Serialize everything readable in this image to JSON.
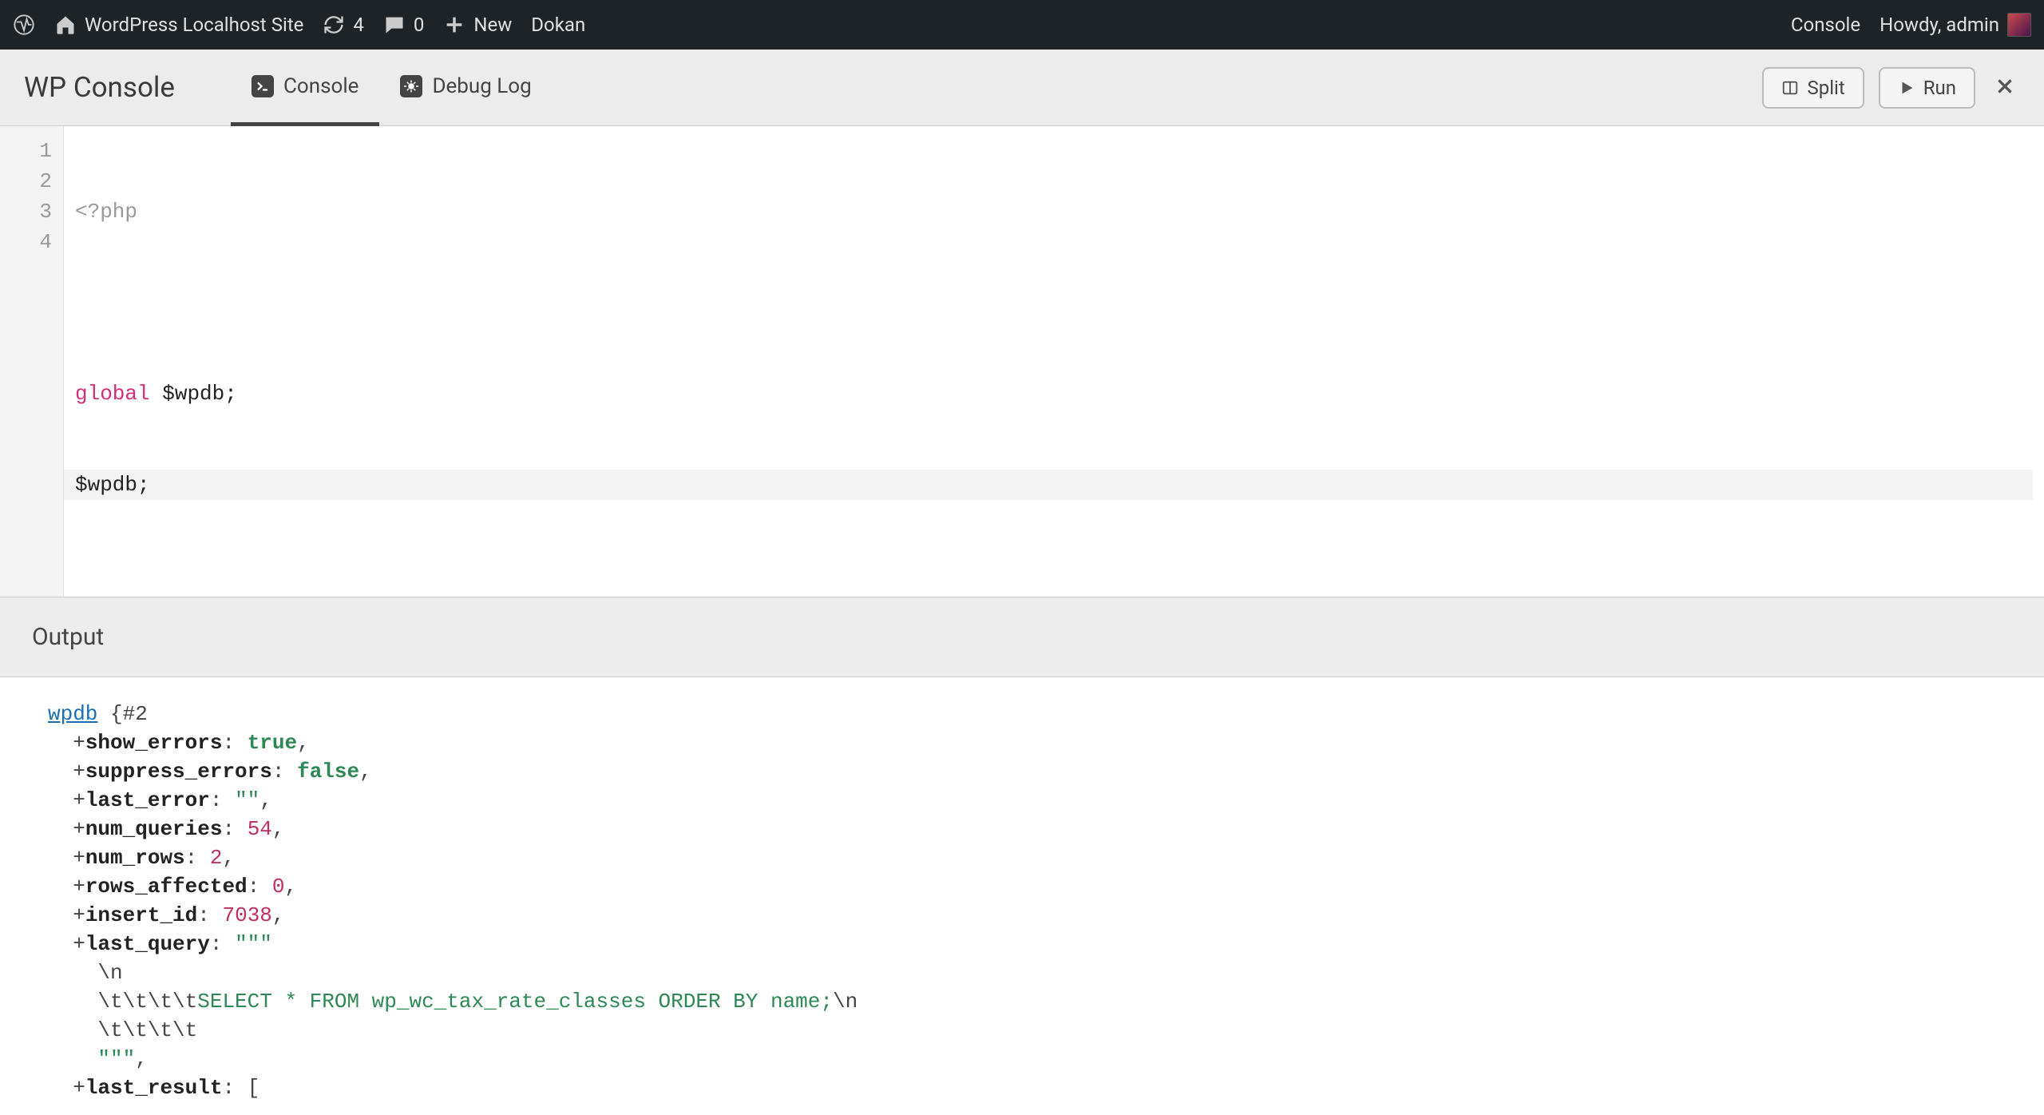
{
  "adminbar": {
    "site_name": "WordPress Localhost Site",
    "update_count": "4",
    "comment_count": "0",
    "new_label": "New",
    "extra_item": "Dokan",
    "right_console": "Console",
    "howdy": "Howdy, admin"
  },
  "panel": {
    "title": "WP Console",
    "tabs": [
      {
        "id": "console",
        "label": "Console",
        "active": true
      },
      {
        "id": "debug_log",
        "label": "Debug Log",
        "active": false
      }
    ],
    "split_label": "Split",
    "run_label": "Run"
  },
  "editor": {
    "line_numbers": [
      "1",
      "2",
      "3",
      "4"
    ],
    "lines": [
      {
        "kind": "meta",
        "raw": "<?php"
      },
      {
        "kind": "blank",
        "raw": ""
      },
      {
        "kind": "global",
        "kw": "global",
        "var": "$wpdb",
        "punct": ";"
      },
      {
        "kind": "stmt",
        "var": "$wpdb",
        "punct": ";",
        "current": true
      }
    ]
  },
  "output_label": "Output",
  "output": {
    "class_name": "wpdb",
    "obj_open": " {#2",
    "indent": "  ",
    "indent2": "    ",
    "props": {
      "show_errors": {
        "plus": "+",
        "key": "show_errors",
        "colon": ": ",
        "val": "true",
        "vclass": "o-true",
        "trail": ","
      },
      "suppress_errors": {
        "plus": "+",
        "key": "suppress_errors",
        "colon": ": ",
        "val": "false",
        "vclass": "o-false",
        "trail": ","
      },
      "last_error": {
        "plus": "+",
        "key": "last_error",
        "colon": ": ",
        "val": "\"\"",
        "vclass": "o-str",
        "trail": ","
      },
      "num_queries": {
        "plus": "+",
        "key": "num_queries",
        "colon": ": ",
        "val": "54",
        "vclass": "o-num",
        "trail": ","
      },
      "num_rows": {
        "plus": "+",
        "key": "num_rows",
        "colon": ": ",
        "val": "2",
        "vclass": "o-num",
        "trail": ","
      },
      "rows_affected": {
        "plus": "+",
        "key": "rows_affected",
        "colon": ": ",
        "val": "0",
        "vclass": "o-num",
        "trail": ","
      },
      "insert_id": {
        "plus": "+",
        "key": "insert_id",
        "colon": ": ",
        "val": "7038",
        "vclass": "o-num",
        "trail": ","
      },
      "last_query_key": {
        "plus": "+",
        "key": "last_query",
        "colon": ": ",
        "triple": "\"\"\""
      },
      "lq_line1_esc": "\\n",
      "lq_line2_esc": "\\t\\t\\t\\t",
      "lq_line2_sql": "SELECT * FROM wp_wc_tax_rate_classes ORDER BY name;",
      "lq_line2_trail": "\\n",
      "lq_line3_esc": "\\t\\t\\t\\t",
      "lq_close_triple": "\"\"\"",
      "lq_close_trail": ",",
      "last_result": {
        "plus": "+",
        "key": "last_result",
        "colon": ": ",
        "val": "[",
        "vclass": "o-punct",
        "trail": ""
      }
    }
  }
}
